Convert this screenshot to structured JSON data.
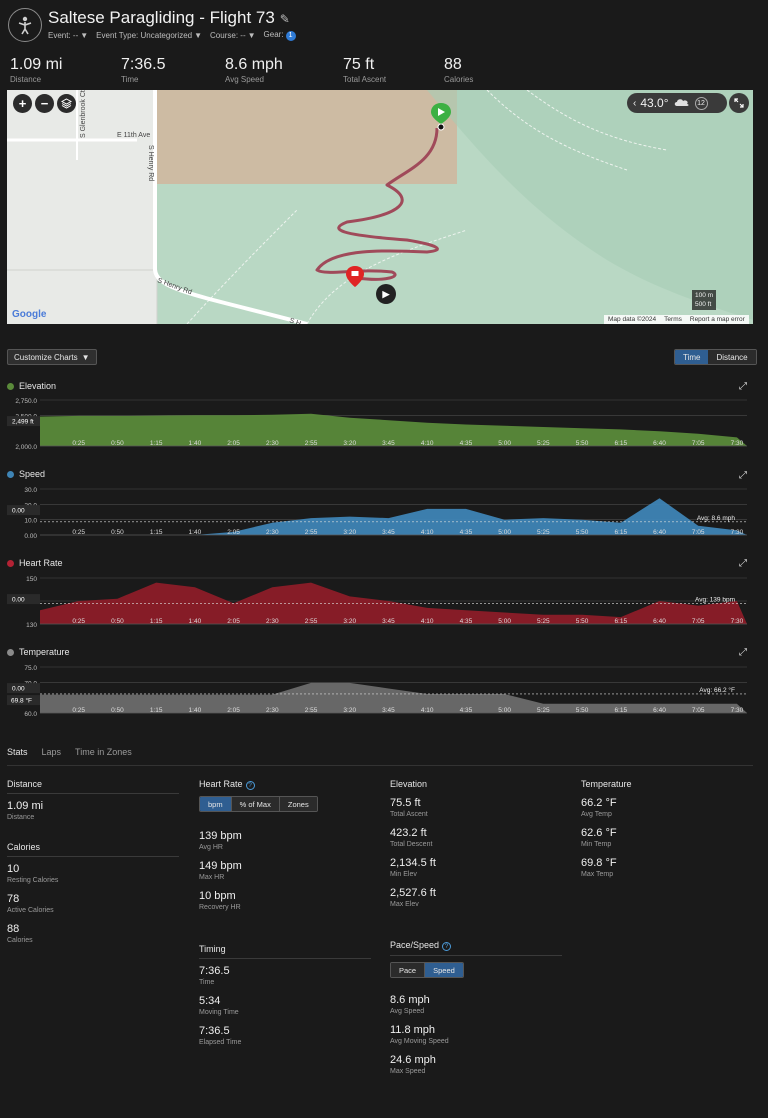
{
  "header": {
    "title": "Saltese Paragliding - Flight 73",
    "meta": [
      {
        "label": "Event:",
        "value": "--"
      },
      {
        "label": "Event Type:",
        "value": "Uncategorized"
      },
      {
        "label": "Course:",
        "value": "--"
      },
      {
        "label": "Gear:",
        "value": "1"
      }
    ]
  },
  "summary": [
    {
      "value": "1.09 mi",
      "label": "Distance"
    },
    {
      "value": "7:36.5",
      "label": "Time"
    },
    {
      "value": "8.6 mph",
      "label": "Avg Speed"
    },
    {
      "value": "75 ft",
      "label": "Total Ascent"
    },
    {
      "value": "88",
      "label": "Calories"
    }
  ],
  "map": {
    "weather_temp": "43.0°",
    "weather_wind": "12",
    "streets": [
      "S Glenbrook Ct",
      "E 11th Ave",
      "S Henry Rd",
      "S Henry Rd",
      "S H"
    ],
    "scale": [
      "100 m",
      "500 ft"
    ],
    "google": "Google",
    "footer": [
      "Map data ©2024",
      "Terms",
      "Report a map error"
    ],
    "icons": [
      "zoom-in-icon",
      "zoom-out-icon",
      "layers-icon",
      "start-flag-icon",
      "finish-flag-icon",
      "play-icon"
    ]
  },
  "controls": {
    "customize": "Customize Charts",
    "toggle": [
      "Time",
      "Distance"
    ],
    "toggle_active": "Time"
  },
  "x_ticks": [
    "0:25",
    "0:50",
    "1:15",
    "1:40",
    "2:05",
    "2:30",
    "2:55",
    "3:20",
    "3:45",
    "4:10",
    "4:35",
    "5:00",
    "5:25",
    "5:50",
    "6:15",
    "6:40",
    "7:05",
    "7:30"
  ],
  "chart_data": [
    {
      "type": "area",
      "title": "Elevation",
      "color": "#5a8a3a",
      "y_ticks": [
        "2,750.0",
        "2,500.0",
        "2,000.0"
      ],
      "ylim": [
        2000,
        2750
      ],
      "hover_label": "2,499 ft",
      "x": [
        "0:00",
        "0:25",
        "0:50",
        "1:15",
        "1:40",
        "2:05",
        "2:30",
        "2:55",
        "3:20",
        "3:45",
        "4:10",
        "4:35",
        "5:00",
        "5:25",
        "5:50",
        "6:15",
        "6:40",
        "7:05",
        "7:30"
      ],
      "values": [
        2480,
        2490,
        2490,
        2495,
        2500,
        2500,
        2510,
        2527,
        2460,
        2420,
        2380,
        2350,
        2330,
        2310,
        2290,
        2270,
        2240,
        2200,
        2140
      ]
    },
    {
      "type": "area",
      "title": "Speed",
      "color": "#3e84b5",
      "y_ticks": [
        "30.0",
        "20.0",
        "10.0",
        "0.00"
      ],
      "ylim": [
        0,
        30
      ],
      "hover_label": "0.00",
      "avg_label": "Avg: 8.6 mph",
      "avg": 8.6,
      "x": [
        "0:00",
        "0:25",
        "0:50",
        "1:15",
        "1:40",
        "2:05",
        "2:30",
        "2:55",
        "3:20",
        "3:45",
        "4:10",
        "4:35",
        "5:00",
        "5:25",
        "5:50",
        "6:15",
        "6:40",
        "7:05",
        "7:30"
      ],
      "values": [
        0,
        0,
        0,
        0,
        0,
        2,
        8,
        11,
        12,
        11,
        17,
        17,
        10,
        11,
        10,
        8,
        24,
        6,
        3
      ]
    },
    {
      "type": "area",
      "title": "Heart Rate",
      "color": "#8c1c28",
      "y_ticks": [
        "150",
        "140",
        "130"
      ],
      "ylim": [
        130,
        150
      ],
      "hover_label": "0.00",
      "avg_label": "Avg: 139 bpm",
      "avg": 139,
      "x": [
        "0:00",
        "0:25",
        "0:50",
        "1:15",
        "1:40",
        "2:05",
        "2:30",
        "2:55",
        "3:20",
        "3:45",
        "4:10",
        "4:35",
        "5:00",
        "5:25",
        "5:50",
        "6:15",
        "6:40",
        "7:05",
        "7:30"
      ],
      "values": [
        136,
        140,
        141,
        148,
        146,
        139,
        146,
        148,
        142,
        140,
        137,
        136,
        135,
        134,
        134,
        133,
        140,
        138,
        140
      ]
    },
    {
      "type": "area",
      "title": "Temperature",
      "color": "#6b6b6b",
      "y_ticks": [
        "75.0",
        "70.0",
        "60.0"
      ],
      "ylim": [
        60,
        75
      ],
      "hover_label": "0.00",
      "hover_value": "69.8 °F",
      "avg_label": "Avg: 66.2 °F",
      "avg": 66.2,
      "x": [
        "0:00",
        "0:25",
        "0:50",
        "1:15",
        "1:40",
        "2:05",
        "2:30",
        "2:55",
        "3:20",
        "3:45",
        "4:10",
        "4:35",
        "5:00",
        "5:25",
        "5:50",
        "6:15",
        "6:40",
        "7:05",
        "7:30"
      ],
      "values": [
        66,
        66,
        66,
        66,
        66,
        66,
        66,
        69.8,
        69.8,
        68,
        66.2,
        66.2,
        66.2,
        63,
        63,
        63,
        63,
        63,
        63
      ]
    }
  ],
  "stats": {
    "tabs": [
      "Stats",
      "Laps",
      "Time in Zones"
    ],
    "distance": {
      "head": "Distance",
      "items": [
        {
          "v": "1.09 mi",
          "l": "Distance"
        }
      ]
    },
    "calories": {
      "head": "Calories",
      "items": [
        {
          "v": "10",
          "l": "Resting Calories"
        },
        {
          "v": "78",
          "l": "Active Calories"
        },
        {
          "v": "88",
          "l": "Calories"
        }
      ]
    },
    "heart": {
      "head": "Heart Rate",
      "seg": [
        "bpm",
        "% of Max",
        "Zones"
      ],
      "items": [
        {
          "v": "139 bpm",
          "l": "Avg HR"
        },
        {
          "v": "149 bpm",
          "l": "Max HR"
        },
        {
          "v": "10 bpm",
          "l": "Recovery HR"
        }
      ]
    },
    "timing": {
      "head": "Timing",
      "items": [
        {
          "v": "7:36.5",
          "l": "Time"
        },
        {
          "v": "5:34",
          "l": "Moving Time"
        },
        {
          "v": "7:36.5",
          "l": "Elapsed Time"
        }
      ]
    },
    "elevation": {
      "head": "Elevation",
      "items": [
        {
          "v": "75.5 ft",
          "l": "Total Ascent"
        },
        {
          "v": "423.2 ft",
          "l": "Total Descent"
        },
        {
          "v": "2,134.5 ft",
          "l": "Min Elev"
        },
        {
          "v": "2,527.6 ft",
          "l": "Max Elev"
        }
      ]
    },
    "pace": {
      "head": "Pace/Speed",
      "seg": [
        "Pace",
        "Speed"
      ],
      "items": [
        {
          "v": "8.6 mph",
          "l": "Avg Speed"
        },
        {
          "v": "11.8 mph",
          "l": "Avg Moving Speed"
        },
        {
          "v": "24.6 mph",
          "l": "Max Speed"
        }
      ]
    },
    "temperature": {
      "head": "Temperature",
      "items": [
        {
          "v": "66.2 °F",
          "l": "Avg Temp"
        },
        {
          "v": "62.6 °F",
          "l": "Min Temp"
        },
        {
          "v": "69.8 °F",
          "l": "Max Temp"
        }
      ]
    }
  }
}
